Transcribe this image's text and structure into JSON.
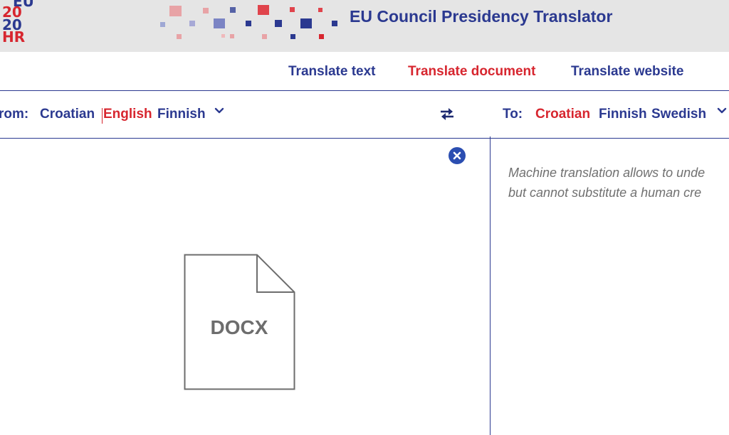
{
  "header": {
    "logo": {
      "row1": "EU",
      "row2": "20",
      "row3": "20",
      "row4": "HR"
    },
    "title": "EU Council Presidency Translator"
  },
  "nav": {
    "items": [
      {
        "label": "Translate text",
        "active": false
      },
      {
        "label": "Translate document",
        "active": true
      },
      {
        "label": "Translate website",
        "active": false
      }
    ]
  },
  "language_bar": {
    "from_label": "rom:",
    "from_languages": [
      {
        "label": "Croatian",
        "selected": false
      },
      {
        "label": "English",
        "selected": true
      },
      {
        "label": "Finnish",
        "selected": false
      }
    ],
    "to_label": "To:",
    "to_languages": [
      {
        "label": "Croatian",
        "selected": true
      },
      {
        "label": "Finnish",
        "selected": false
      },
      {
        "label": "Swedish",
        "selected": false
      }
    ],
    "icons": {
      "from_dropdown": "chevron-down-icon",
      "swap": "swap-arrows-icon",
      "to_dropdown": "chevron-down-icon"
    }
  },
  "source_pane": {
    "file_type": "DOCX",
    "close_icon": "close-icon"
  },
  "target_pane": {
    "disclaimer_line1": "Machine translation allows to unde",
    "disclaimer_line2": "but cannot substitute a human cre"
  },
  "colors": {
    "brand_blue": "#2b3990",
    "accent_red": "#d7262f",
    "header_bg": "#e5e5e5"
  }
}
